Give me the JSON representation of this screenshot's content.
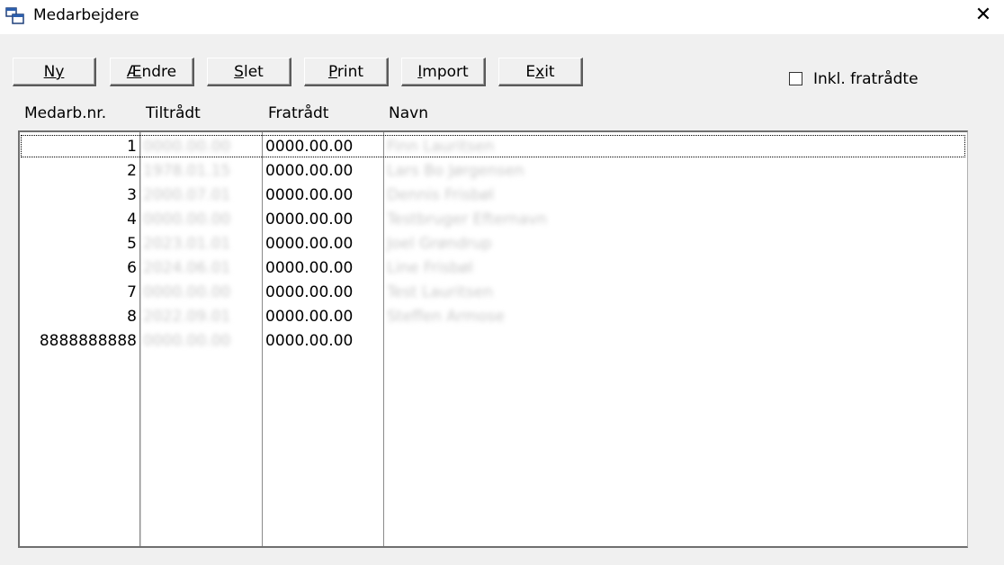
{
  "window": {
    "title": "Medarbejdere"
  },
  "toolbar": {
    "buttons": [
      {
        "pre": "",
        "accel": "Ny",
        "post": ""
      },
      {
        "pre": "",
        "accel": "Æ",
        "post": "ndre"
      },
      {
        "pre": "",
        "accel": "S",
        "post": "let"
      },
      {
        "pre": "",
        "accel": "P",
        "post": "rint"
      },
      {
        "pre": "",
        "accel": "I",
        "post": "mport"
      },
      {
        "pre": "E",
        "accel": "x",
        "post": "it"
      }
    ],
    "include_resigned": {
      "label": "Inkl. fratrådte",
      "checked": false
    }
  },
  "table": {
    "headers": [
      "Medarb.nr.",
      "Tiltrådt",
      "Fratrådt",
      "Navn"
    ],
    "rows": [
      {
        "nr": "1",
        "tiltraadt": "0000.00.00",
        "fratraadt": "0000.00.00",
        "navn": "Finn Lauritsen",
        "selected": true
      },
      {
        "nr": "2",
        "tiltraadt": "1978.01.15",
        "fratraadt": "0000.00.00",
        "navn": "Lars Bo Jørgensen",
        "selected": false
      },
      {
        "nr": "3",
        "tiltraadt": "2000.07.01",
        "fratraadt": "0000.00.00",
        "navn": "Dennis Frisbøl",
        "selected": false
      },
      {
        "nr": "4",
        "tiltraadt": "0000.00.00",
        "fratraadt": "0000.00.00",
        "navn": "Testbruger Efternavn",
        "selected": false
      },
      {
        "nr": "5",
        "tiltraadt": "2023.01.01",
        "fratraadt": "0000.00.00",
        "navn": "Joel Grøndrup",
        "selected": false
      },
      {
        "nr": "6",
        "tiltraadt": "2024.06.01",
        "fratraadt": "0000.00.00",
        "navn": "Line Frisbøl",
        "selected": false
      },
      {
        "nr": "7",
        "tiltraadt": "0000.00.00",
        "fratraadt": "0000.00.00",
        "navn": "Test Lauritsen",
        "selected": false
      },
      {
        "nr": "8",
        "tiltraadt": "2022.09.01",
        "fratraadt": "0000.00.00",
        "navn": "Steffen Armose",
        "selected": false
      },
      {
        "nr": "8888888888",
        "tiltraadt": "0000.00.00",
        "fratraadt": "0000.00.00",
        "navn": "",
        "selected": false
      }
    ]
  }
}
